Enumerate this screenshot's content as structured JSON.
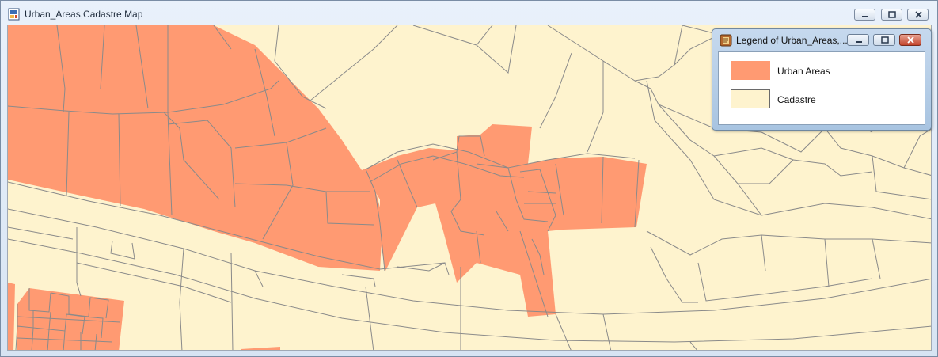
{
  "window": {
    "title": "Urban_Areas,Cadastre Map",
    "icon": "map-document-icon"
  },
  "colors": {
    "urban": "#ff9a72",
    "cadastre": "#fef3ce",
    "parcel_line": "#8a8a8a",
    "legend_close": "#c2432b"
  },
  "legend": {
    "title": "Legend of Urban_Areas,...",
    "icon": "legend-icon",
    "items": [
      {
        "label": "Urban Areas",
        "color": "#ff9a72"
      },
      {
        "label": "Cadastre",
        "color": "#fef3ce"
      }
    ]
  }
}
